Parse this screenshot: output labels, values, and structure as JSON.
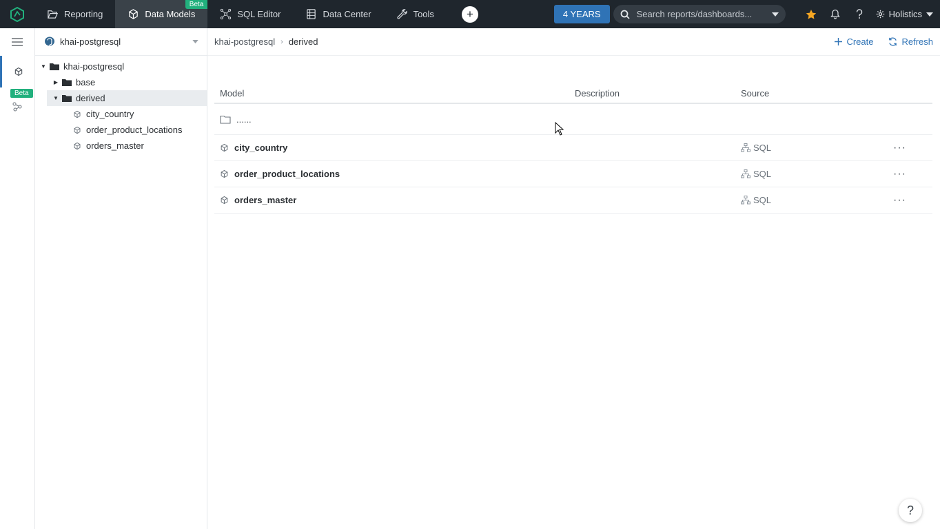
{
  "topnav": {
    "items": [
      {
        "label": "Reporting",
        "icon": "folder-open-icon"
      },
      {
        "label": "Data Models",
        "icon": "cube-icon",
        "badge": "Beta",
        "active": true
      },
      {
        "label": "SQL Editor",
        "icon": "nodes-icon"
      },
      {
        "label": "Data Center",
        "icon": "database-icon"
      },
      {
        "label": "Tools",
        "icon": "wrench-icon"
      }
    ],
    "plus_label": "+",
    "time_range": "4 YEARS",
    "search_placeholder": "Search reports/dashboards...",
    "user_label": "Holistics"
  },
  "rail": {
    "beta_badge": "Beta"
  },
  "tree": {
    "datasource": "khai-postgresql",
    "root": "khai-postgresql",
    "folders": [
      {
        "label": "base",
        "expanded": false
      },
      {
        "label": "derived",
        "expanded": true,
        "selected": true
      }
    ],
    "models": [
      "city_country",
      "order_product_locations",
      "orders_master"
    ]
  },
  "main": {
    "breadcrumb": {
      "parent": "khai-postgresql",
      "current": "derived"
    },
    "create_label": "Create",
    "refresh_label": "Refresh",
    "columns": {
      "model": "Model",
      "description": "Description",
      "source": "Source"
    },
    "parent_row": "......",
    "rows": [
      {
        "name": "city_country",
        "description": "",
        "source": "SQL"
      },
      {
        "name": "order_product_locations",
        "description": "",
        "source": "SQL"
      },
      {
        "name": "orders_master",
        "description": "",
        "source": "SQL"
      }
    ],
    "more_label": "···",
    "help_label": "?"
  },
  "colors": {
    "topbar_bg": "#1f262d",
    "accent_blue": "#2f73b6",
    "beta_green": "#22b07d",
    "star": "#f5a623"
  }
}
